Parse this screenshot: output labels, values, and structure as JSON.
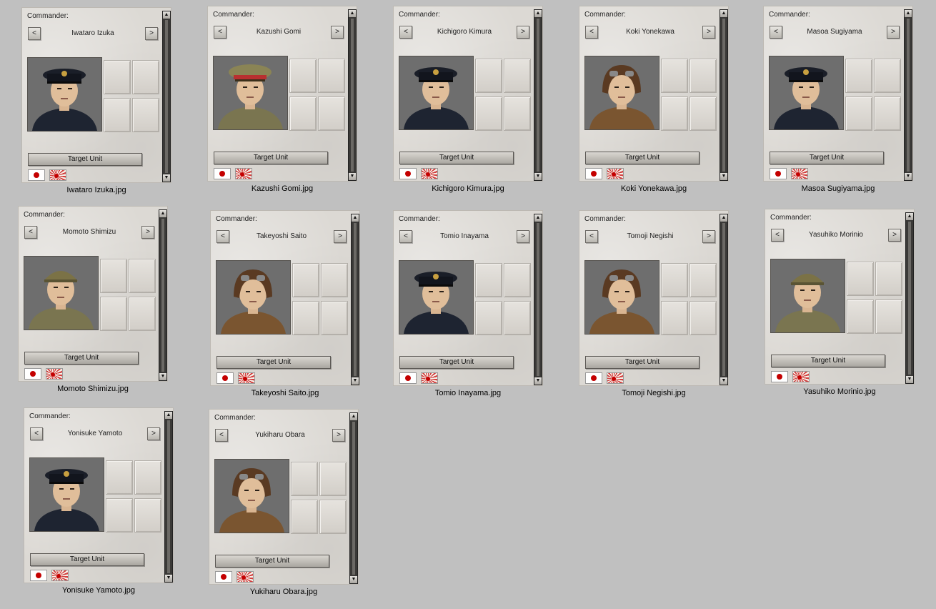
{
  "labels": {
    "commander": "Commander:",
    "prev": "<",
    "next": ">",
    "target_unit": "Target Unit",
    "scroll_up": "▲",
    "scroll_down": "▼"
  },
  "colors": {
    "background": "#c0c0c0",
    "card": "#dcd9d4",
    "flag_red": "#c40000"
  },
  "commanders": [
    {
      "name": "Iwataro Izuka",
      "file": "Iwataro Izuka.jpg",
      "uniform": "navy",
      "headgear": "navy-cap"
    },
    {
      "name": "Kazushi Gomi",
      "file": "Kazushi Gomi.jpg",
      "uniform": "army",
      "headgear": "army-cap"
    },
    {
      "name": "Kichigoro Kimura",
      "file": "Kichigoro Kimura.jpg",
      "uniform": "navy",
      "headgear": "navy-cap"
    },
    {
      "name": "Koki Yonekawa",
      "file": "Koki Yonekawa.jpg",
      "uniform": "pilot",
      "headgear": "flight-helmet"
    },
    {
      "name": "Masoa Sugiyama",
      "file": "Masoa Sugiyama.jpg",
      "uniform": "navy",
      "headgear": "navy-cap"
    },
    {
      "name": "Momoto Shimizu",
      "file": "Momoto Shimizu.jpg",
      "uniform": "army",
      "headgear": "field-cap"
    },
    {
      "name": "Takeyoshi Saito",
      "file": "Takeyoshi Saito.jpg",
      "uniform": "pilot",
      "headgear": "flight-helmet"
    },
    {
      "name": "Tomio Inayama",
      "file": "Tomio Inayama.jpg",
      "uniform": "navy",
      "headgear": "navy-cap"
    },
    {
      "name": "Tomoji Negishi",
      "file": "Tomoji Negishi.jpg",
      "uniform": "pilot",
      "headgear": "flight-helmet"
    },
    {
      "name": "Yasuhiko Morinio",
      "file": "Yasuhiko Morinio.jpg",
      "uniform": "army",
      "headgear": "field-cap"
    },
    {
      "name": "Yonisuke Yamoto",
      "file": "Yonisuke Yamoto.jpg",
      "uniform": "navy",
      "headgear": "navy-cap"
    },
    {
      "name": "Yukiharu Obara",
      "file": "Yukiharu Obara.jpg",
      "uniform": "pilot",
      "headgear": "flight-helmet"
    }
  ]
}
